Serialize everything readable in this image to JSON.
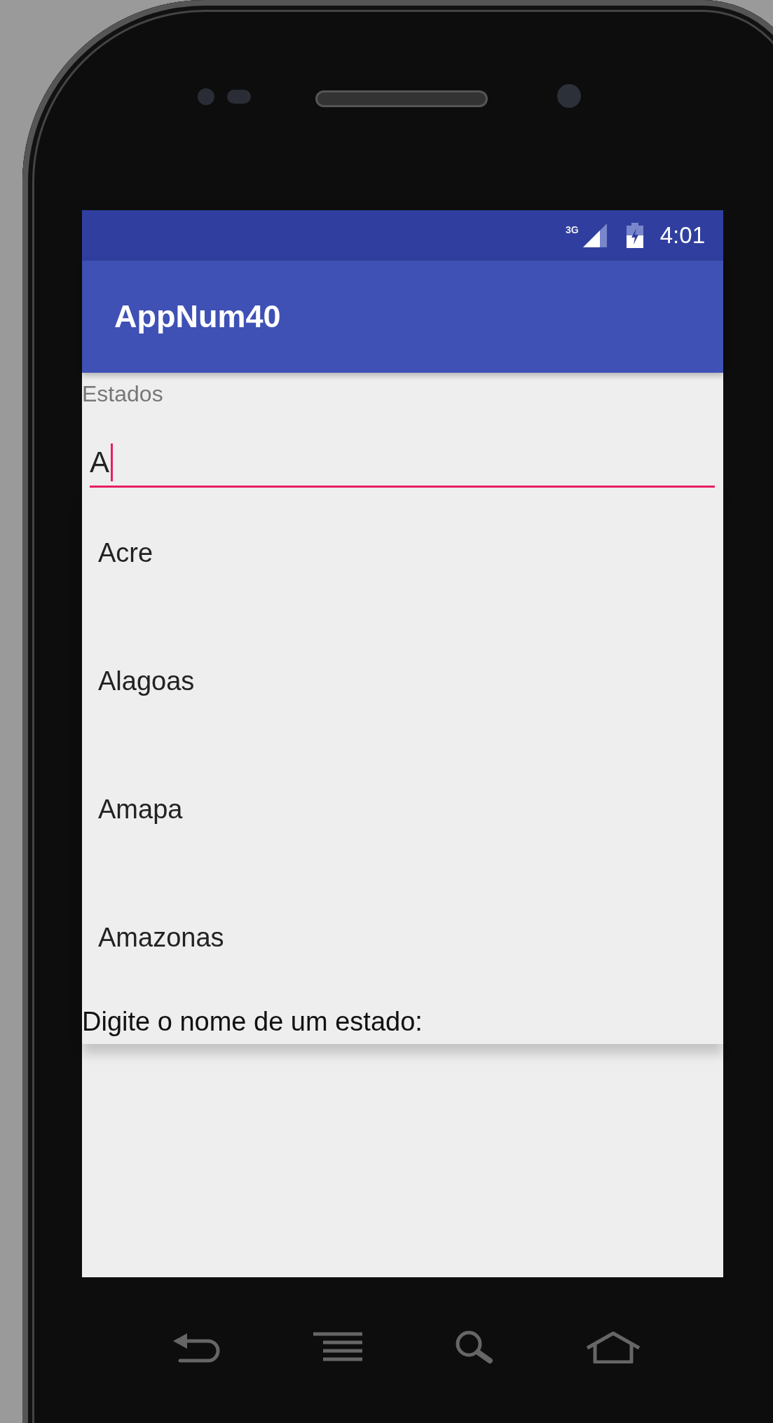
{
  "status_bar": {
    "network": "3G",
    "time": "4:01"
  },
  "app_bar": {
    "title": "AppNum40"
  },
  "field": {
    "label": "Estados",
    "value": "A",
    "focused": true
  },
  "suggestions": [
    {
      "text": "Acre"
    },
    {
      "text": "Alagoas"
    },
    {
      "text": "Amapa"
    },
    {
      "text": "Amazonas"
    }
  ],
  "prompt": "Digite o nome de um estado:"
}
